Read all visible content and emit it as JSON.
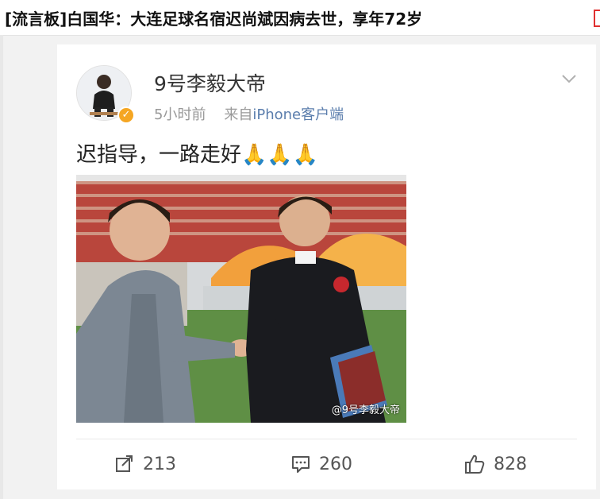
{
  "headline": {
    "text": "[流言板]白国华：大连足球名宿迟尚斌因病去世，享年72岁"
  },
  "post": {
    "username": "9号李毅大帝",
    "time": "5小时前",
    "source_prefix": "来自",
    "source": "iPhone客户端",
    "text": "迟指导，一路走好",
    "emoji": "🙏🙏🙏",
    "image_watermark": "@9号李毅大帝"
  },
  "actions": {
    "reposts": "213",
    "comments": "260",
    "likes": "828"
  },
  "colors": {
    "accent_link": "#5b7ead",
    "verified_badge": "#f5a623",
    "corner_tab": "#e03030"
  }
}
